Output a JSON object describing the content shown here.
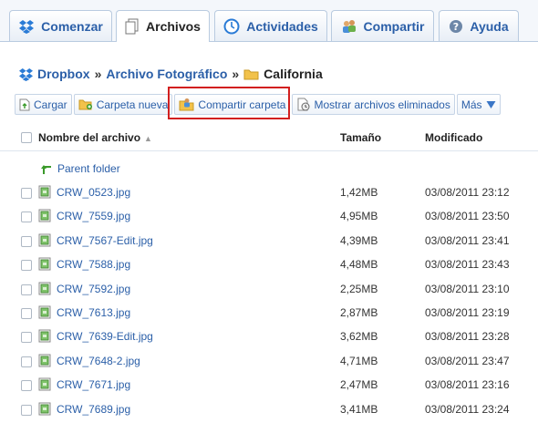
{
  "tabs": [
    {
      "label": "Comenzar",
      "icon": "dropbox-icon"
    },
    {
      "label": "Archivos",
      "icon": "files-icon"
    },
    {
      "label": "Actividades",
      "icon": "clock-icon"
    },
    {
      "label": "Compartir",
      "icon": "share-people-icon"
    },
    {
      "label": "Ayuda",
      "icon": "help-icon"
    }
  ],
  "breadcrumb": {
    "root": "Dropbox",
    "folder": "Archivo Fotográfico",
    "separator": "»",
    "current": "California"
  },
  "toolbar": {
    "upload": "Cargar",
    "new_folder": "Carpeta nueva",
    "share_folder": "Compartir carpeta",
    "show_deleted": "Mostrar archivos eliminados",
    "more": "Más"
  },
  "table": {
    "col_name": "Nombre del archivo",
    "col_size": "Tamaño",
    "col_modified": "Modificado",
    "parent_folder": "Parent folder",
    "rows": [
      {
        "name": "CRW_0523.jpg",
        "size": "1,42MB",
        "modified": "03/08/2011 23:12"
      },
      {
        "name": "CRW_7559.jpg",
        "size": "4,95MB",
        "modified": "03/08/2011 23:50"
      },
      {
        "name": "CRW_7567-Edit.jpg",
        "size": "4,39MB",
        "modified": "03/08/2011 23:41"
      },
      {
        "name": "CRW_7588.jpg",
        "size": "4,48MB",
        "modified": "03/08/2011 23:43"
      },
      {
        "name": "CRW_7592.jpg",
        "size": "2,25MB",
        "modified": "03/08/2011 23:10"
      },
      {
        "name": "CRW_7613.jpg",
        "size": "2,87MB",
        "modified": "03/08/2011 23:19"
      },
      {
        "name": "CRW_7639-Edit.jpg",
        "size": "3,62MB",
        "modified": "03/08/2011 23:28"
      },
      {
        "name": "CRW_7648-2.jpg",
        "size": "4,71MB",
        "modified": "03/08/2011 23:47"
      },
      {
        "name": "CRW_7671.jpg",
        "size": "2,47MB",
        "modified": "03/08/2011 23:16"
      },
      {
        "name": "CRW_7689.jpg",
        "size": "3,41MB",
        "modified": "03/08/2011 23:24"
      }
    ]
  },
  "colors": {
    "link": "#2b5fa8",
    "highlight": "#d21f1f",
    "folder": "#f2c24b"
  }
}
